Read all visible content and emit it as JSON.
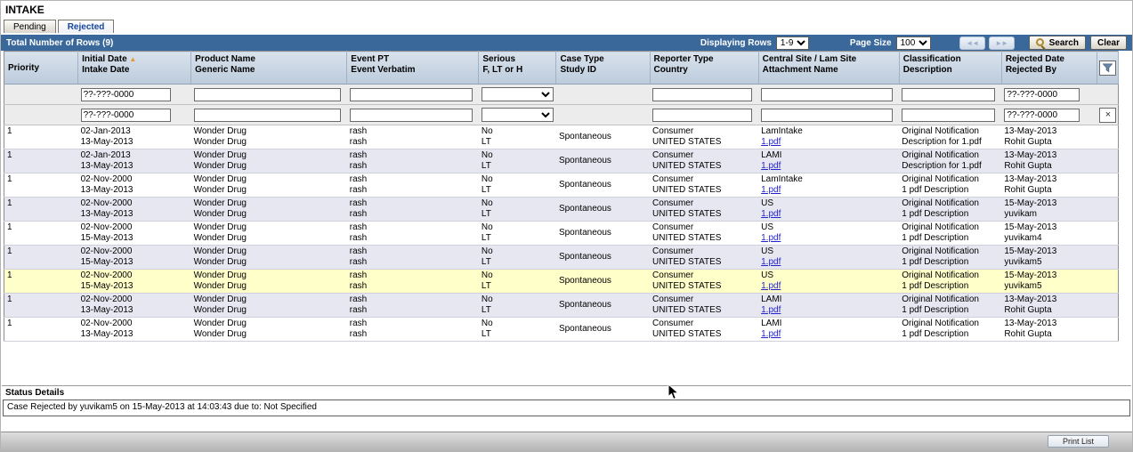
{
  "app": {
    "title": "INTAKE"
  },
  "tabs": [
    {
      "label": "Pending",
      "active": false
    },
    {
      "label": "Rejected",
      "active": true
    }
  ],
  "toolbar": {
    "total_rows": "Total Number of Rows (9)",
    "displaying_rows_label": "Displaying Rows",
    "displaying_rows_value": "1-9",
    "page_size_label": "Page Size",
    "page_size_value": "100",
    "search_label": "Search",
    "clear_label": "Clear"
  },
  "icons": {
    "sort_ascending": "▲",
    "clear_filter": "×",
    "first_page": "◄◄",
    "last_page": "►►"
  },
  "table": {
    "headers": [
      {
        "line1": "Priority",
        "line2": ""
      },
      {
        "line1": "Initial Date",
        "line2": "Intake Date"
      },
      {
        "line1": "Product Name",
        "line2": "Generic Name"
      },
      {
        "line1": "Event PT",
        "line2": "Event Verbatim"
      },
      {
        "line1": "Serious",
        "line2": "F, LT or H"
      },
      {
        "line1": "Case Type",
        "line2": "Study ID"
      },
      {
        "line1": "Reporter Type",
        "line2": "Country"
      },
      {
        "line1": "Central Site / Lam Site",
        "line2": "Attachment Name"
      },
      {
        "line1": "Classification",
        "line2": "Description"
      },
      {
        "line1": "Rejected Date",
        "line2": "Rejected By"
      }
    ],
    "filters": {
      "row1": {
        "initial_date": "??-???-0000",
        "product_name": "",
        "event_pt": "",
        "serious": "",
        "reporter_type": "",
        "central_site": "",
        "classification": "",
        "rejected_date": "??-???-0000"
      },
      "row2": {
        "initial_date": "??-???-0000",
        "product_name": "",
        "event_pt": "",
        "serious": "",
        "reporter_type": "",
        "central_site": "",
        "classification": "",
        "rejected_date": "??-???-0000"
      }
    },
    "rows": [
      {
        "priority": "1",
        "initial_date": "02-Jan-2013",
        "intake_date": "13-May-2013",
        "product_name": "Wonder Drug",
        "generic_name": "Wonder Drug",
        "event_pt": "rash",
        "event_verbatim": "rash",
        "serious": "No",
        "f_lt_h": "LT",
        "case_type": "Spontaneous",
        "study_id": "",
        "reporter_type": "Consumer",
        "country": "UNITED STATES",
        "site": "LamIntake",
        "attachment": "1.pdf",
        "classification": "Original Notification",
        "description": "Description for 1.pdf",
        "rejected_date": "13-May-2013",
        "rejected_by": "Rohit Gupta",
        "selected": false
      },
      {
        "priority": "1",
        "initial_date": "02-Jan-2013",
        "intake_date": "13-May-2013",
        "product_name": "Wonder Drug",
        "generic_name": "Wonder Drug",
        "event_pt": "rash",
        "event_verbatim": "rash",
        "serious": "No",
        "f_lt_h": "LT",
        "case_type": "Spontaneous",
        "study_id": "",
        "reporter_type": "Consumer",
        "country": "UNITED STATES",
        "site": "LAMI",
        "attachment": "1.pdf",
        "classification": "Original Notification",
        "description": "Description for 1.pdf",
        "rejected_date": "13-May-2013",
        "rejected_by": "Rohit Gupta",
        "selected": false
      },
      {
        "priority": "1",
        "initial_date": "02-Nov-2000",
        "intake_date": "13-May-2013",
        "product_name": "Wonder Drug",
        "generic_name": "Wonder Drug",
        "event_pt": "rash",
        "event_verbatim": "rash",
        "serious": "No",
        "f_lt_h": "LT",
        "case_type": "Spontaneous",
        "study_id": "",
        "reporter_type": "Consumer",
        "country": "UNITED STATES",
        "site": "LamIntake",
        "attachment": "1.pdf",
        "classification": "Original Notification",
        "description": "1 pdf Description",
        "rejected_date": "13-May-2013",
        "rejected_by": "Rohit Gupta",
        "selected": false
      },
      {
        "priority": "1",
        "initial_date": "02-Nov-2000",
        "intake_date": "13-May-2013",
        "product_name": "Wonder Drug",
        "generic_name": "Wonder Drug",
        "event_pt": "rash",
        "event_verbatim": "rash",
        "serious": "No",
        "f_lt_h": "LT",
        "case_type": "Spontaneous",
        "study_id": "",
        "reporter_type": "Consumer",
        "country": "UNITED STATES",
        "site": "US",
        "attachment": "1.pdf",
        "classification": "Original Notification",
        "description": "1 pdf Description",
        "rejected_date": "15-May-2013",
        "rejected_by": "yuvikam",
        "selected": false
      },
      {
        "priority": "1",
        "initial_date": "02-Nov-2000",
        "intake_date": "15-May-2013",
        "product_name": "Wonder Drug",
        "generic_name": "Wonder Drug",
        "event_pt": "rash",
        "event_verbatim": "rash",
        "serious": "No",
        "f_lt_h": "LT",
        "case_type": "Spontaneous",
        "study_id": "",
        "reporter_type": "Consumer",
        "country": "UNITED STATES",
        "site": "US",
        "attachment": "1.pdf",
        "classification": "Original Notification",
        "description": "1 pdf Description",
        "rejected_date": "15-May-2013",
        "rejected_by": "yuvikam4",
        "selected": false
      },
      {
        "priority": "1",
        "initial_date": "02-Nov-2000",
        "intake_date": "15-May-2013",
        "product_name": "Wonder Drug",
        "generic_name": "Wonder Drug",
        "event_pt": "rash",
        "event_verbatim": "rash",
        "serious": "No",
        "f_lt_h": "LT",
        "case_type": "Spontaneous",
        "study_id": "",
        "reporter_type": "Consumer",
        "country": "UNITED STATES",
        "site": "US",
        "attachment": "1.pdf",
        "classification": "Original Notification",
        "description": "1 pdf Description",
        "rejected_date": "15-May-2013",
        "rejected_by": "yuvikam5",
        "selected": false
      },
      {
        "priority": "1",
        "initial_date": "02-Nov-2000",
        "intake_date": "15-May-2013",
        "product_name": "Wonder Drug",
        "generic_name": "Wonder Drug",
        "event_pt": "rash",
        "event_verbatim": "rash",
        "serious": "No",
        "f_lt_h": "LT",
        "case_type": "Spontaneous",
        "study_id": "",
        "reporter_type": "Consumer",
        "country": "UNITED STATES",
        "site": "US",
        "attachment": "1.pdf",
        "classification": "Original Notification",
        "description": "1 pdf Description",
        "rejected_date": "15-May-2013",
        "rejected_by": "yuvikam5",
        "selected": true
      },
      {
        "priority": "1",
        "initial_date": "02-Nov-2000",
        "intake_date": "13-May-2013",
        "product_name": "Wonder Drug",
        "generic_name": "Wonder Drug",
        "event_pt": "rash",
        "event_verbatim": "rash",
        "serious": "No",
        "f_lt_h": "LT",
        "case_type": "Spontaneous",
        "study_id": "",
        "reporter_type": "Consumer",
        "country": "UNITED STATES",
        "site": "LAMI",
        "attachment": "1.pdf",
        "classification": "Original Notification",
        "description": "1 pdf Description",
        "rejected_date": "13-May-2013",
        "rejected_by": "Rohit Gupta",
        "selected": false
      },
      {
        "priority": "1",
        "initial_date": "02-Nov-2000",
        "intake_date": "13-May-2013",
        "product_name": "Wonder Drug",
        "generic_name": "Wonder Drug",
        "event_pt": "rash",
        "event_verbatim": "rash",
        "serious": "No",
        "f_lt_h": "LT",
        "case_type": "Spontaneous",
        "study_id": "",
        "reporter_type": "Consumer",
        "country": "UNITED STATES",
        "site": "LAMI",
        "attachment": "1.pdf",
        "classification": "Original Notification",
        "description": "1 pdf Description",
        "rejected_date": "13-May-2013",
        "rejected_by": "Rohit Gupta",
        "selected": false
      }
    ]
  },
  "status": {
    "title": "Status Details",
    "message": "Case Rejected by yuvikam5 on 15-May-2013 at 14:03:43 due to: Not Specified"
  },
  "footer": {
    "print_label": "Print List"
  },
  "colors": {
    "toolbar_bg": "#3a689b",
    "header_bg": "#c6d3e1",
    "row_alt_bg": "#e7e7f1",
    "row_selected_bg": "#ffffca",
    "link": "#2323cc"
  }
}
